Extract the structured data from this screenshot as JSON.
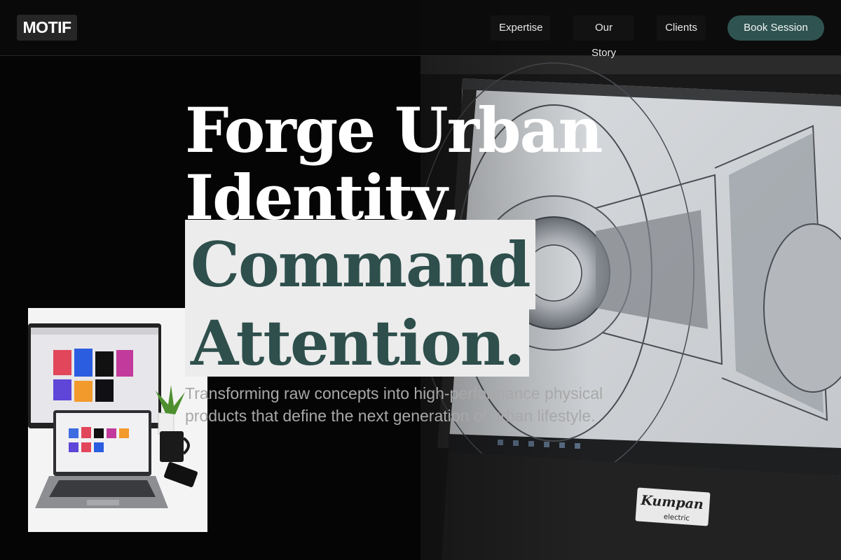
{
  "header": {
    "logo": "MOTIF",
    "nav": [
      "Expertise",
      "Our Story",
      "Clients"
    ],
    "cta": "Book Session"
  },
  "hero": {
    "headline_line1": "Forge Urban",
    "headline_line2": "Identity,",
    "headline_line3": "Command",
    "headline_line4": "Attention.",
    "subtitle": "Transforming raw concepts into high-performance physical products that define the next generation of urban lifestyle."
  },
  "images": {
    "background": "monitor-cad-drawing-photo",
    "inset": "laptop-monitor-desk-photo",
    "monitor_brand": "Kumpan electric"
  },
  "colors": {
    "accent": "#2f5350",
    "highlight_bg": "#ececec",
    "highlight_text": "#2e4f4c",
    "background": "#050505"
  }
}
